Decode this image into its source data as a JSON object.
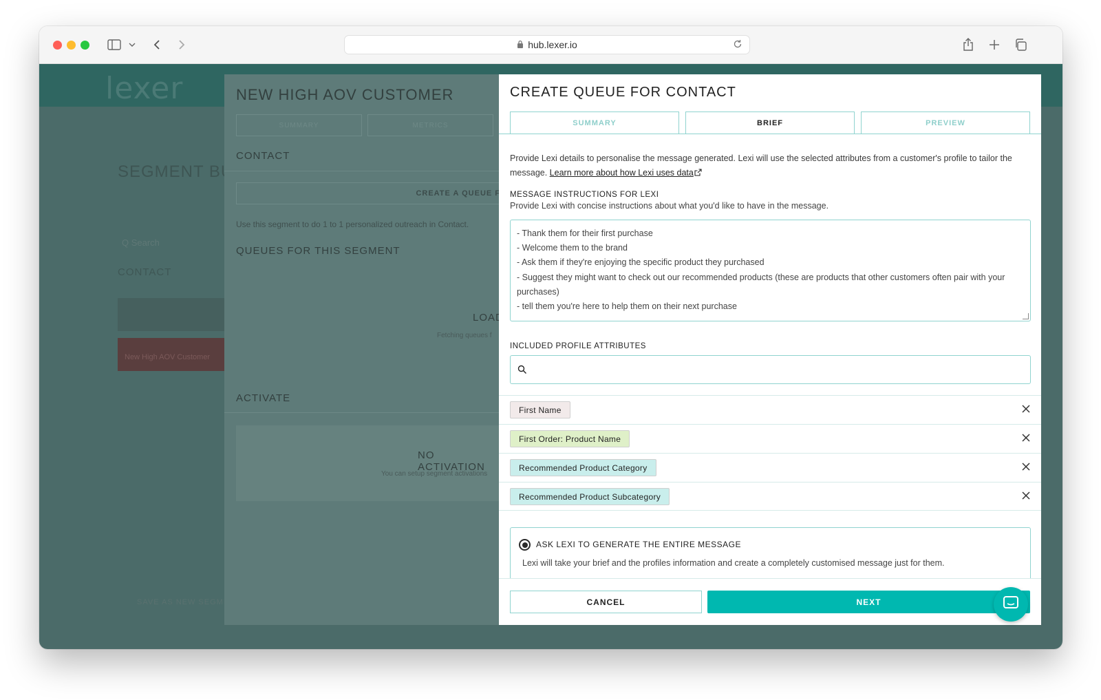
{
  "browser": {
    "url": "hub.lexer.io"
  },
  "background": {
    "logo": "lexer",
    "title": "SEGMENT BU",
    "search_placeholder": "Q Search",
    "contact": "CONTACT",
    "card_text": "New High AOV Customer",
    "save": "SAVE AS NEW SEGMENT"
  },
  "drawer": {
    "title": "NEW HIGH AOV CUSTOMER",
    "tabs": [
      "SUMMARY",
      "METRICS"
    ],
    "contact_heading": "CONTACT",
    "create_queue_label": "CREATE A QUEUE F",
    "description": "Use this segment to do 1 to 1 personalized outreach in Contact.",
    "queues_heading": "QUEUES FOR THIS SEGMENT",
    "loading": "LOAD",
    "fetching": "Fetching queues f",
    "activate_heading": "ACTIVATE",
    "no_activations": "NO ACTIVATION",
    "no_activations_sub": "You can setup segment activations"
  },
  "modal": {
    "title": "CREATE QUEUE FOR CONTACT",
    "tabs": [
      {
        "label": "SUMMARY",
        "active": false
      },
      {
        "label": "BRIEF",
        "active": true
      },
      {
        "label": "PREVIEW",
        "active": false
      }
    ],
    "intro_text": "Provide Lexi details to personalise the message generated. Lexi will use the selected attributes from a customer's profile to tailor the message. ",
    "intro_link": "Learn more about how Lexi uses data",
    "instructions_label": "MESSAGE INSTRUCTIONS FOR LEXI",
    "instructions_sub": "Provide Lexi with concise instructions about what you'd like to have in the message.",
    "instructions_lines": [
      "- Thank them for their first purchase",
      "- Welcome them to the brand",
      "- Ask them if they're enjoying the specific product they purchased",
      "- Suggest they might want to check out our recommended products (these are products that other customers often pair with your purchases)",
      "- tell them you're here to help them on their next purchase"
    ],
    "attributes_label": "INCLUDED PROFILE ATTRIBUTES",
    "attributes": [
      {
        "label": "First Name",
        "color": "#f2eaea"
      },
      {
        "label": "First Order: Product Name",
        "color": "#dff0c8"
      },
      {
        "label": "Recommended Product Category",
        "color": "#c9eeec"
      },
      {
        "label": "Recommended Product Subcategory",
        "color": "#c9eeec"
      }
    ],
    "radio_label": "ASK LEXI TO GENERATE THE ENTIRE MESSAGE",
    "radio_desc": "Lexi will take your brief and the profiles information and create a completely customised message just for them.",
    "cancel_label": "CANCEL",
    "next_label": "NEXT"
  },
  "colors": {
    "accent": "#00b8b0",
    "border": "#8fd3cf"
  }
}
